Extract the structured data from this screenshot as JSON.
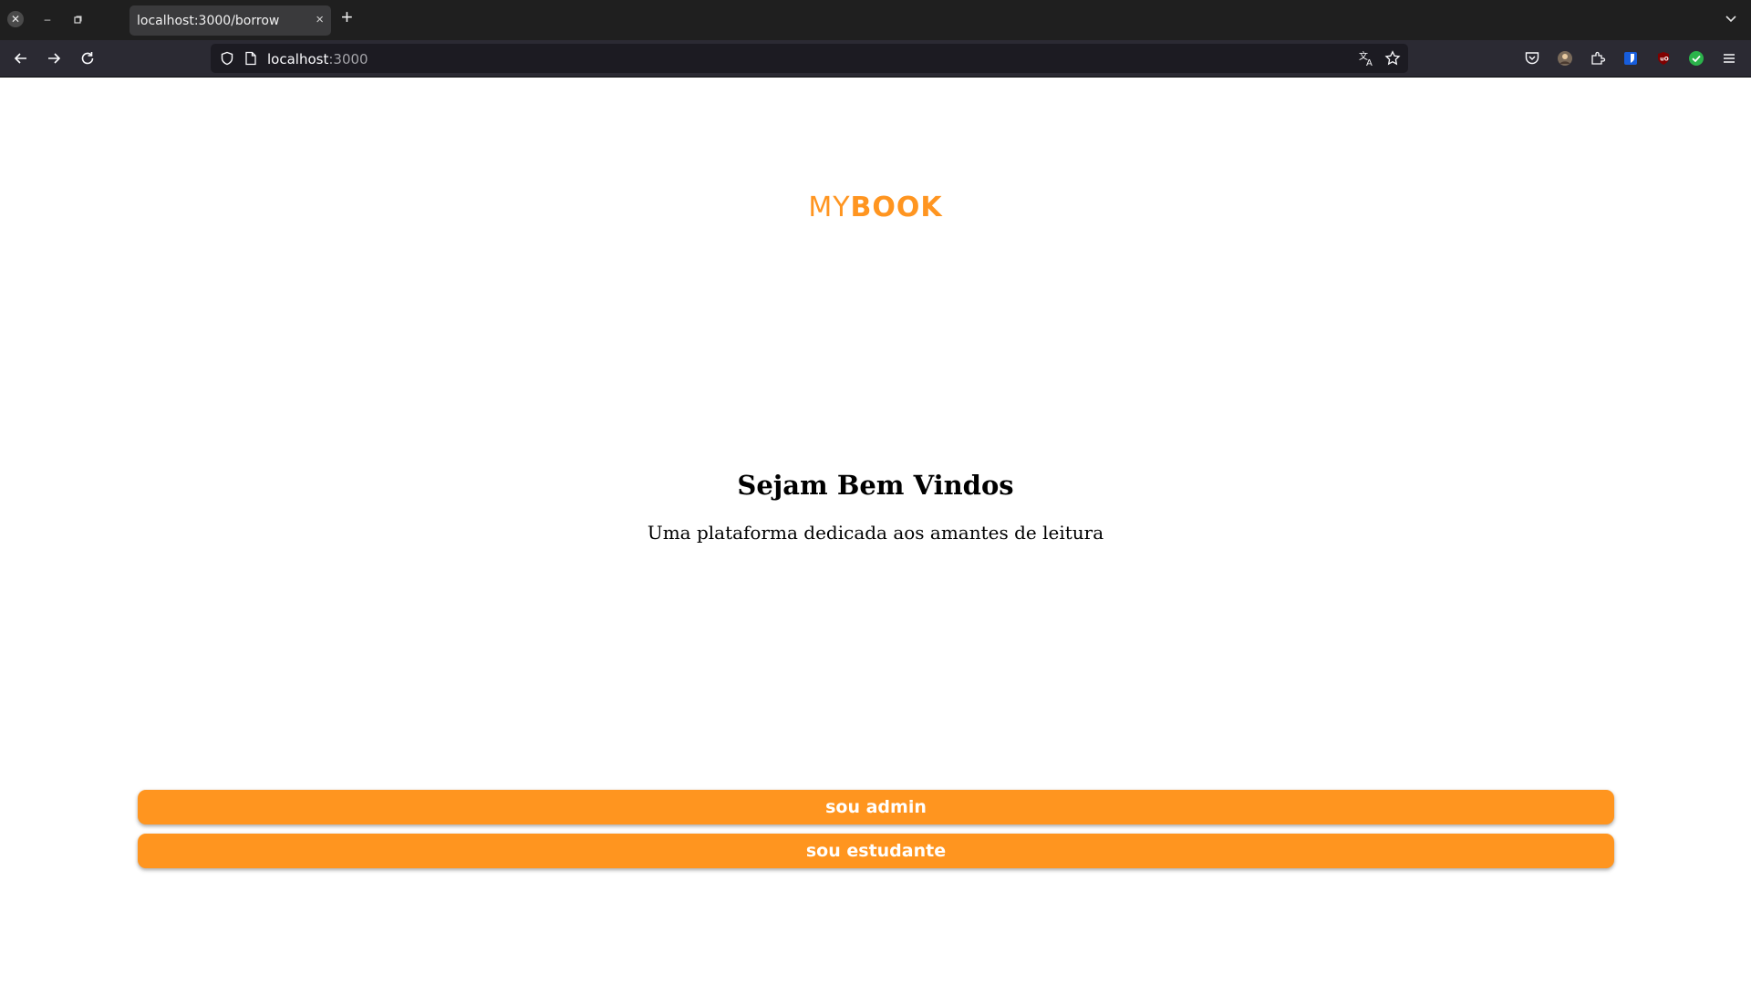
{
  "browser": {
    "tab": {
      "title": "localhost:3000/borrow",
      "close_glyph": "×"
    },
    "new_tab_glyph": "+",
    "url": {
      "host": "localhost",
      "port": ":3000"
    },
    "icons": {
      "back": "back-arrow-icon",
      "forward": "forward-arrow-icon",
      "reload": "reload-icon",
      "shield": "tracking-shield-icon",
      "page": "page-info-icon",
      "translate": "translate-icon",
      "bookmark": "bookmark-star-icon",
      "pocket": "pocket-icon",
      "account": "account-avatar-icon",
      "extensions": "extensions-puzzle-icon",
      "menu": "hamburger-menu-icon"
    }
  },
  "page": {
    "brand": {
      "prefix": "MY",
      "suffix": "BOOK",
      "color": "#ff9520"
    },
    "welcome_title": "Sejam Bem Vindos",
    "tagline": "Uma plataforma dedicada aos amantes de leitura",
    "buttons": {
      "admin": "sou admin",
      "student": "sou estudante"
    },
    "accent_color": "#ff951f"
  }
}
